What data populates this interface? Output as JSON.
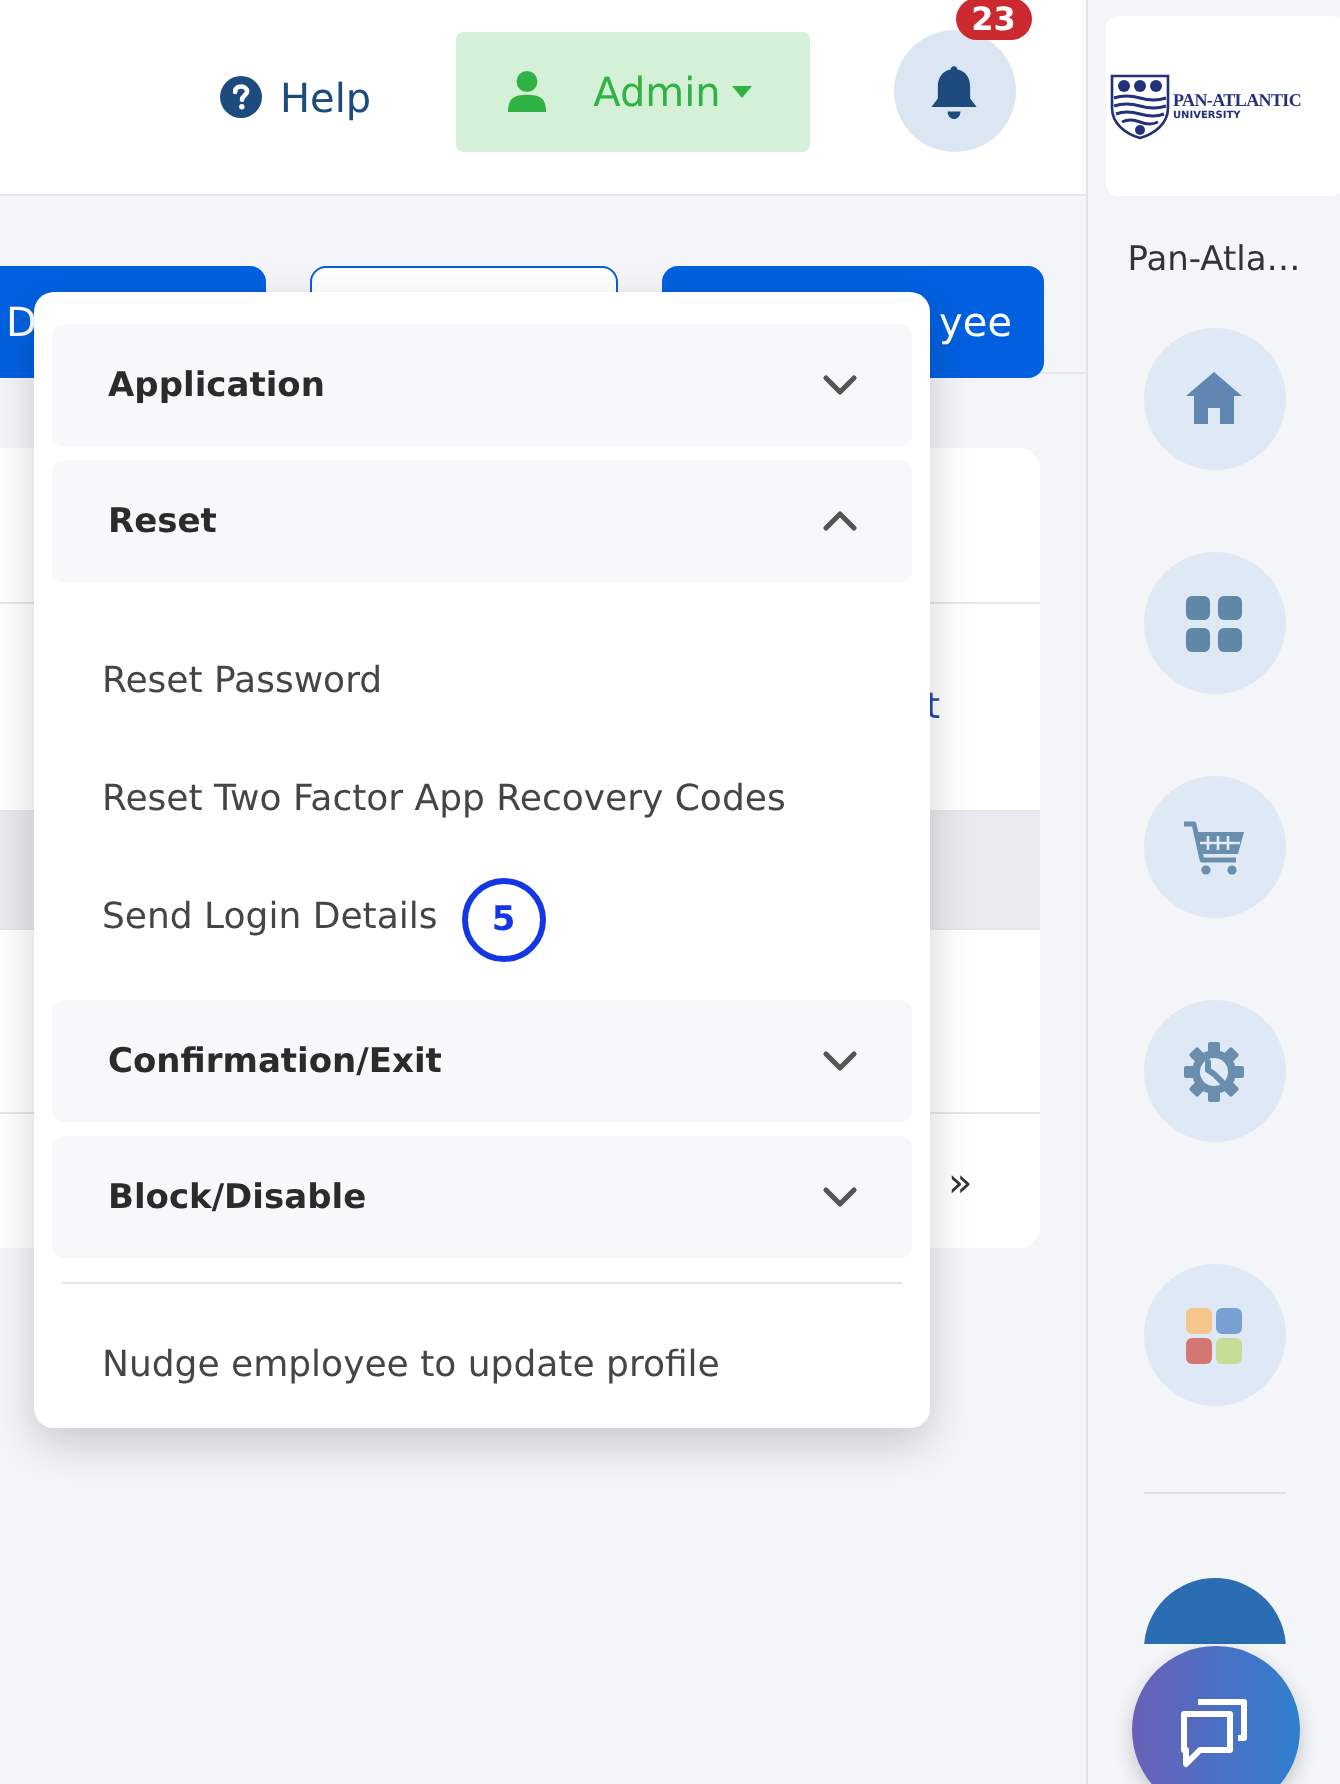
{
  "header": {
    "help": "Help",
    "user_menu": "Admin",
    "notifications": "23"
  },
  "toolbar_buttons": [
    {
      "kind": "primary",
      "label": "D"
    },
    {
      "kind": "outline"
    },
    {
      "kind": "primary",
      "label": "yee"
    }
  ],
  "table": {
    "rows": [
      {
        "selected": false
      },
      {
        "selected": false,
        "cell": "t"
      },
      {
        "selected": true
      },
      {
        "selected": false
      },
      {
        "selected": false,
        "cell": "»"
      }
    ]
  },
  "dropdown": {
    "sections": [
      {
        "title": "Application",
        "expanded": false
      },
      {
        "title": "Reset",
        "expanded": true,
        "items": [
          {
            "label": "Reset Password"
          },
          {
            "label": "Reset Two Factor App Recovery Codes"
          },
          {
            "label": "Send Login Details",
            "badge": "5"
          }
        ]
      },
      {
        "title": "Confirmation/Exit",
        "expanded": false
      },
      {
        "title": "Block/Disable",
        "expanded": false
      }
    ],
    "footer_item": "Nudge employee to update profile"
  },
  "sidebar": {
    "logo": {
      "name": "PAN-ATLANTIC",
      "subtitle": "UNIVERSITY"
    },
    "org_name": "Pan-Atla…",
    "nav": [
      {
        "kind": "home"
      },
      {
        "kind": "dashboard"
      },
      {
        "kind": "cart"
      },
      {
        "kind": "settings"
      },
      {
        "kind": "apps"
      }
    ]
  }
}
